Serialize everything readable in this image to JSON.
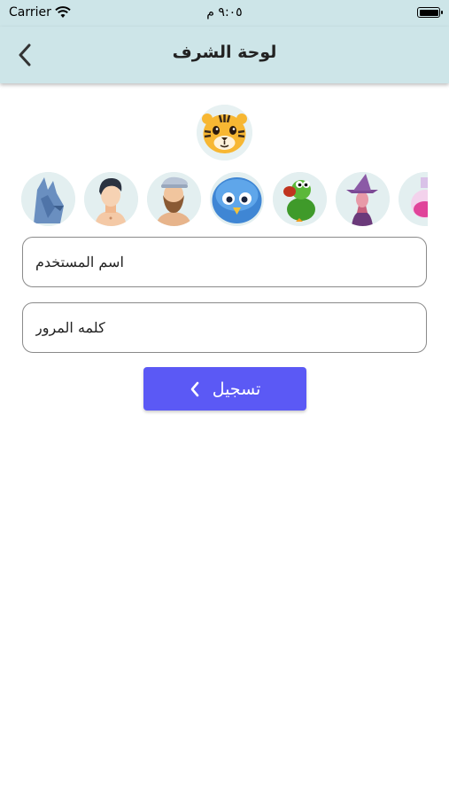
{
  "status_bar": {
    "carrier": "Carrier",
    "time": "٩:٠٥ م"
  },
  "nav": {
    "title": "لوحة الشرف"
  },
  "avatars": {
    "selected": "tiger",
    "items": [
      "wolf",
      "boy",
      "bearded-man",
      "blue-bird",
      "duck",
      "witch",
      "potion"
    ]
  },
  "form": {
    "username_placeholder": "اسم المستخدم",
    "password_placeholder": "كلمه المرور",
    "username_value": "",
    "password_value": ""
  },
  "register_button": {
    "label": "تسجيل"
  },
  "colors": {
    "header_bg": "#cde5e8",
    "button_bg": "#5b59f5",
    "avatar_bg": "#e3eff0"
  }
}
